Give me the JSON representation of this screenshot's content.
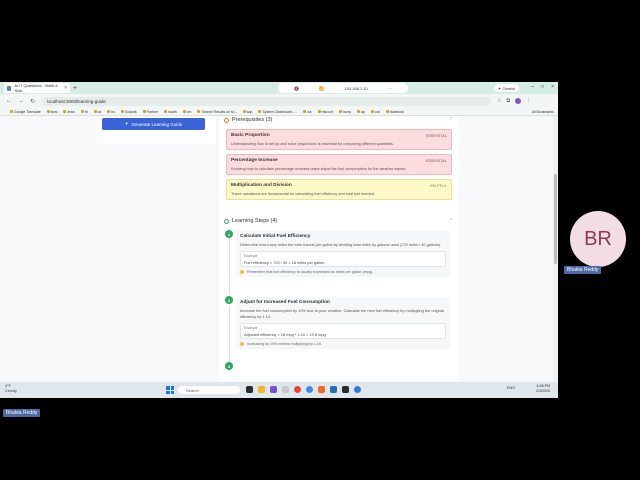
{
  "browser": {
    "tab_title": "ACT Questions - Math & Scie...",
    "new_tab": "+",
    "cast_items": [
      "🔇",
      "📶",
      "192.168.1.10",
      "⋯"
    ],
    "gemini_label": "✦ Gemini",
    "url": "localhost:3000/learning-guide",
    "bookmarks": [
      "Google Translate",
      "strat",
      "ersw",
      "fit",
      "dz",
      "bs",
      "Scipark",
      "Partner",
      "sauth",
      "cm",
      "Search Results on M...",
      "sap",
      "System Dashboard -...",
      "wk",
      "mkconf",
      "hcow",
      "ap",
      "cdr",
      "facebook"
    ],
    "all_bookmarks": "All Bookmarks"
  },
  "page": {
    "generate_button": "Generate Learning Guide",
    "prerequisites_heading": "Prerequisites (3)",
    "prerequisites": [
      {
        "title": "Basic Proportion",
        "tag": "ESSENTIAL",
        "desc": "Understanding how to set up and solve proportions is essential for comparing different quantities.",
        "level": "red"
      },
      {
        "title": "Percentage Increase",
        "tag": "ESSENTIAL",
        "desc": "Knowing how to calculate percentage increase helps adjust the fuel consumption for the weather impact.",
        "level": "red"
      },
      {
        "title": "Multiplication and Division",
        "tag": "HELPFUL",
        "desc": "These operations are fundamental for calculating fuel efficiency and total fuel needed.",
        "level": "yellow"
      }
    ],
    "steps_heading": "Learning Steps (4)",
    "steps": [
      {
        "num": "1",
        "title": "Calculate Initial Fuel Efficiency",
        "desc": "Determine how many miles the train travels per gallon by dividing total miles by gallons used (720 miles / 40 gallons).",
        "example_label": "Example",
        "example": "Fuel efficiency = 720 / 40 = 18 miles per gallon.",
        "tip": "Remember that fuel efficiency is usually expressed as miles per gallon (mpg)."
      },
      {
        "num": "2",
        "title": "Adjust for Increased Fuel Consumption",
        "desc": "Increase the fuel consumption by 10% due to poor weather. Calculate the new fuel efficiency by multiplying the original efficiency by 1.10.",
        "example_label": "Example",
        "example": "Adjusted efficiency = 18 mpg * 1.10 = 19.8 mpg",
        "tip": "Increasing by 10% means multiplying by 1.10."
      },
      {
        "num": "3"
      }
    ]
  },
  "taskbar": {
    "weather_temp": "4°F",
    "weather_desc": "Cloudy",
    "search": "Search",
    "tray": "ENG",
    "time": "6:48 PM",
    "date": "2/3/2026"
  },
  "call": {
    "initials": "BR",
    "participant_name": "Bhakta Reddy",
    "self_name": "Bhakta Reddy"
  }
}
